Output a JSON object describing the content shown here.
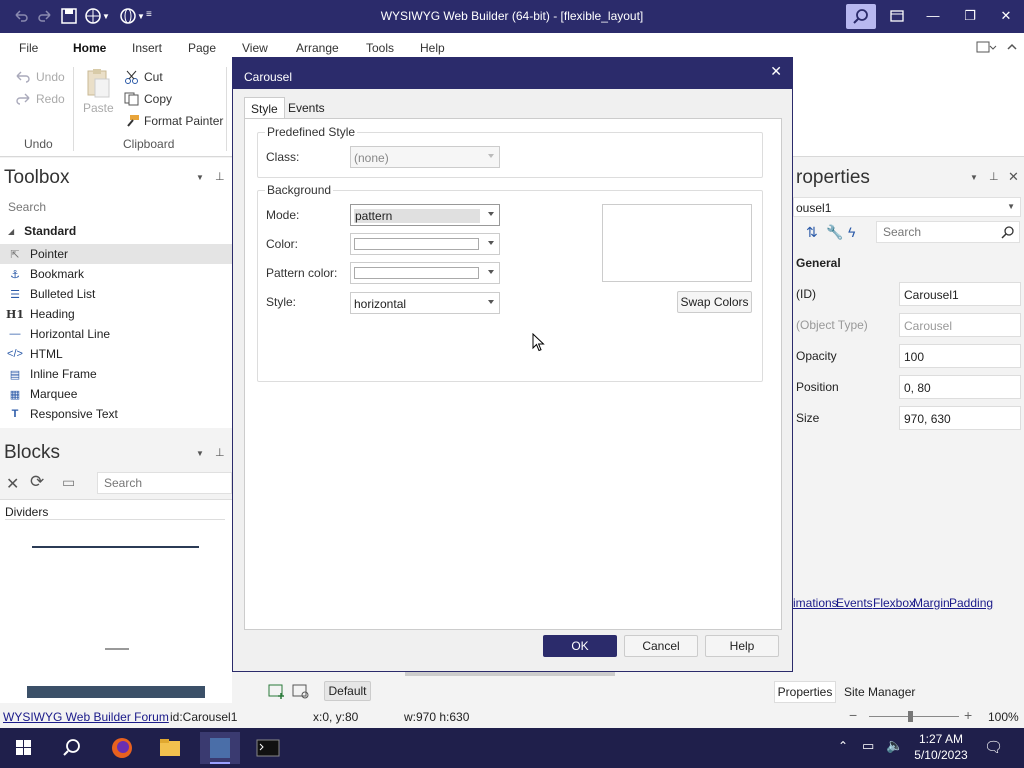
{
  "window": {
    "title": "WYSIWYG Web Builder (64-bit) - [flexible_layout]"
  },
  "ribbon": {
    "tabs": [
      "File",
      "Home",
      "Insert",
      "Page",
      "View",
      "Arrange",
      "Tools",
      "Help"
    ],
    "undo": "Undo",
    "redo": "Redo",
    "paste": "Paste",
    "cut": "Cut",
    "copy": "Copy",
    "format_painter": "Format Painter",
    "group_undo": "Undo",
    "group_clipboard": "Clipboard"
  },
  "toolbox": {
    "title": "Toolbox",
    "search_placeholder": "Search",
    "category": "Standard",
    "items": [
      "Pointer",
      "Bookmark",
      "Bulleted List",
      "Heading",
      "Horizontal Line",
      "HTML",
      "Inline Frame",
      "Marquee",
      "Responsive Text"
    ]
  },
  "blocks": {
    "title": "Blocks",
    "search_placeholder": "Search",
    "category": "Dividers"
  },
  "properties": {
    "title": "roperties",
    "object": "ousel1",
    "search_placeholder": "Search",
    "section": "General",
    "rows": [
      {
        "label": "(ID)",
        "value": "Carousel1",
        "dim": false
      },
      {
        "label": "(Object Type)",
        "value": "Carousel",
        "dim": true
      },
      {
        "label": "Opacity",
        "value": "100",
        "dim": false
      },
      {
        "label": "Position",
        "value": "0, 80",
        "dim": false
      },
      {
        "label": "Size",
        "value": "970, 630",
        "dim": false
      }
    ],
    "links": [
      "imations",
      "Events",
      "Flexbox",
      "Margin",
      "Padding"
    ],
    "bottom_tabs": [
      "Properties",
      "Site Manager"
    ]
  },
  "dialog": {
    "title": "Carousel",
    "tabs": [
      "Style",
      "Events"
    ],
    "predefined_style": {
      "title": "Predefined Style",
      "class_label": "Class:",
      "class_value": "(none)"
    },
    "background": {
      "title": "Background",
      "mode_label": "Mode:",
      "mode_value": "pattern",
      "color_label": "Color:",
      "pattern_color_label": "Pattern color:",
      "style_label": "Style:",
      "style_value": "horizontal",
      "swap_colors": "Swap Colors"
    },
    "ok": "OK",
    "cancel": "Cancel",
    "help": "Help"
  },
  "canvas_bottom": {
    "default_btn": "Default"
  },
  "statusbar": {
    "forum": "WYSIWYG Web Builder Forum",
    "id": "id:Carousel1",
    "pos": "x:0, y:80",
    "size": "w:970 h:630",
    "zoom": "100%"
  },
  "taskbar": {
    "time": "1:27 AM",
    "date": "5/10/2023"
  }
}
